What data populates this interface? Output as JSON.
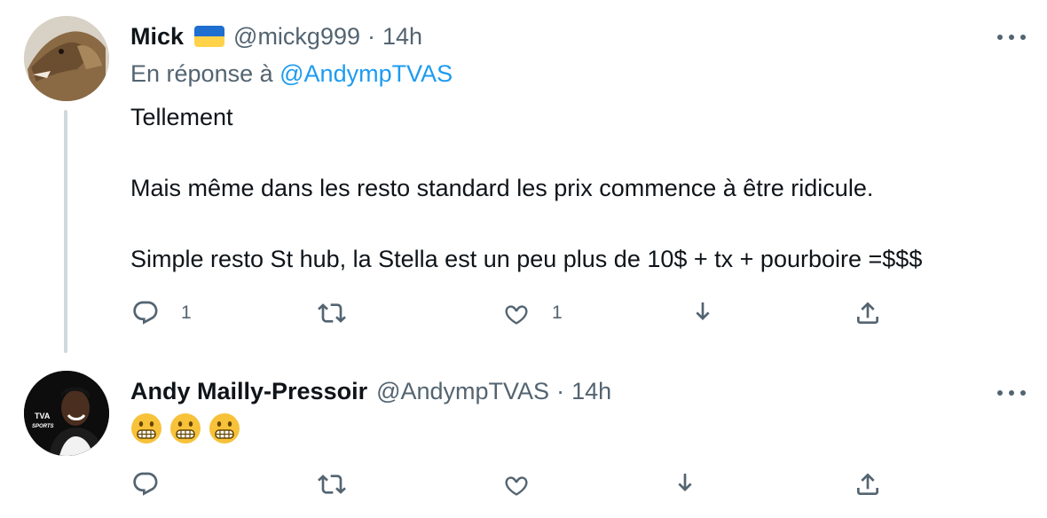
{
  "tweets": [
    {
      "name": "Mick",
      "flag": "ukraine-flag",
      "handle": "@mickg999",
      "separator": "·",
      "time": "14h",
      "reply_prefix": "En réponse à",
      "reply_handle": "@AndympTVAS",
      "body": [
        "Tellement",
        "Mais même dans les resto standard les prix commence à être ridicule.",
        "Simple resto St hub, la Stella est un peu plus de 10$ + tx + pourboire =$$$"
      ],
      "actions": {
        "reply_count": "1",
        "retweet_count": "",
        "like_count": "1"
      }
    },
    {
      "name": "Andy Mailly-Pressoir",
      "handle": "@AndympTVAS",
      "separator": "·",
      "time": "14h",
      "avatar_badge": "TVA SPORTS",
      "emojis": [
        "grimacing-face",
        "grimacing-face",
        "grimacing-face"
      ],
      "actions": {
        "reply_count": "",
        "retweet_count": "",
        "like_count": ""
      }
    }
  ],
  "colors": {
    "text": "#0f1419",
    "secondary": "#536471",
    "link": "#1d9bf0",
    "thread_line": "#cfd9de"
  },
  "icons": [
    "reply-icon",
    "retweet-icon",
    "like-icon",
    "download-icon",
    "share-icon",
    "more-icon"
  ]
}
